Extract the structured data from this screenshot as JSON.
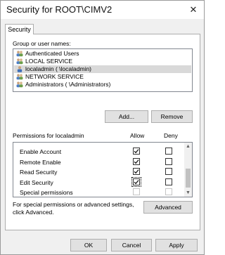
{
  "window": {
    "title": "Security for ROOT\\CIMV2",
    "close_glyph": "✕"
  },
  "tabs": [
    {
      "label": "Security",
      "selected": true
    }
  ],
  "groups": {
    "label": "Group or user names:",
    "items": [
      {
        "name": "Authenticated Users",
        "icon": "user-group-icon",
        "selected": false
      },
      {
        "name": "LOCAL SERVICE",
        "icon": "user-group-icon",
        "selected": false
      },
      {
        "name": "localadmin (                    \\localadmin)",
        "icon": "user-icon",
        "selected": true
      },
      {
        "name": "NETWORK SERVICE",
        "icon": "user-group-icon",
        "selected": false
      },
      {
        "name": "Administrators (                    \\Administrators)",
        "icon": "user-group-icon",
        "selected": false
      }
    ],
    "add_label": "Add...",
    "remove_label": "Remove"
  },
  "permissions": {
    "label": "Permissions for localadmin",
    "allow_header": "Allow",
    "deny_header": "Deny",
    "rows": [
      {
        "name": "Enable Account",
        "allow": true,
        "deny": false,
        "disabled": false
      },
      {
        "name": "Remote Enable",
        "allow": true,
        "deny": false,
        "disabled": false
      },
      {
        "name": "Read Security",
        "allow": true,
        "deny": false,
        "disabled": false
      },
      {
        "name": "Edit Security",
        "allow": true,
        "deny": false,
        "disabled": false,
        "focused": true
      },
      {
        "name": "Special permissions",
        "allow": false,
        "deny": false,
        "disabled": true
      }
    ]
  },
  "advanced": {
    "text_line1": "For special permissions or advanced settings,",
    "text_line2": "click Advanced.",
    "button_label": "Advanced"
  },
  "footer": {
    "ok_label": "OK",
    "cancel_label": "Cancel",
    "apply_label": "Apply"
  }
}
